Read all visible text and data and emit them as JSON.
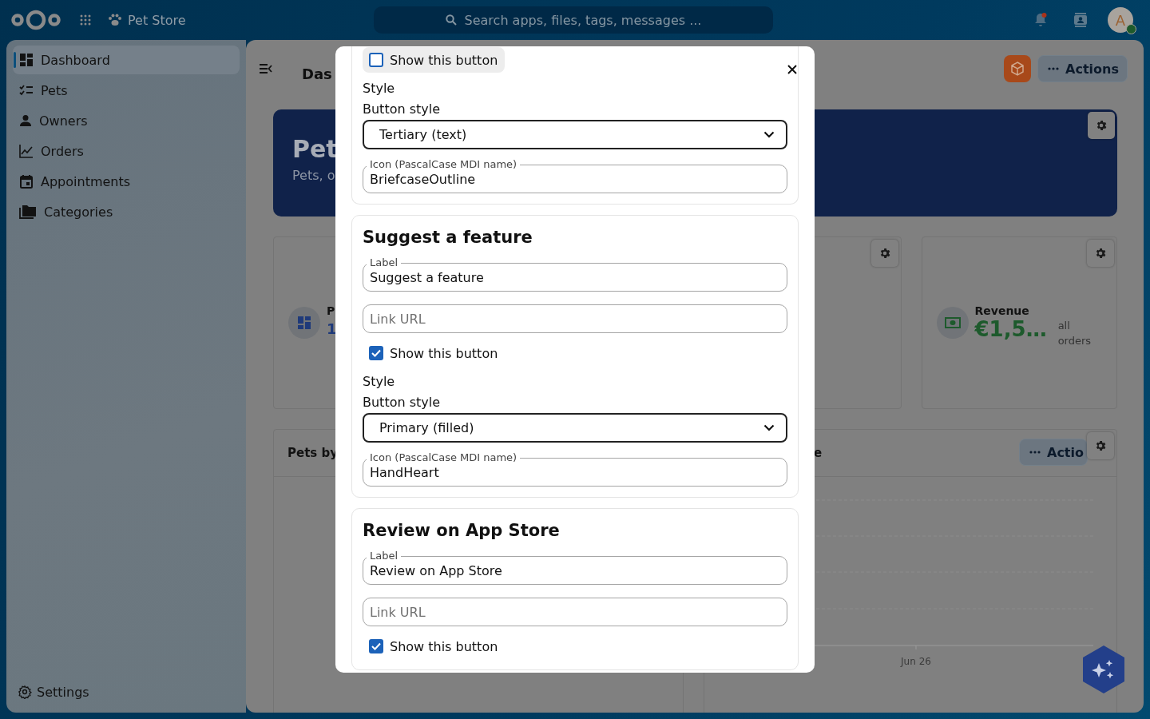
{
  "top_bar": {
    "app_name": "Pet Store",
    "search": {
      "placeholder": "Search apps, files, tags, messages ..."
    },
    "notifications": {
      "unread": true
    },
    "avatar": {
      "initial": "A",
      "online": true
    }
  },
  "sidebar": {
    "items": [
      {
        "label": "Dashboard",
        "selected": true
      },
      {
        "label": "Pets",
        "selected": false
      },
      {
        "label": "Owners",
        "selected": false
      },
      {
        "label": "Orders",
        "selected": false
      },
      {
        "label": "Appointments",
        "selected": false
      },
      {
        "label": "Categories",
        "selected": false
      }
    ],
    "footer": {
      "label": "Settings"
    }
  },
  "header": {
    "title": "Das",
    "actions": {
      "label": "Actions"
    }
  },
  "hero": {
    "title": "Pet",
    "subtitle": "Pets, o"
  },
  "stat_cards": [
    {
      "kind": "stat",
      "label": "P",
      "value": "1",
      "color": "#1f3a7a"
    },
    {
      "kind": "covered"
    },
    {
      "kind": "blank"
    },
    {
      "kind": "stat",
      "label": "Revenue",
      "value": "€1,5…",
      "note": "all orders",
      "color": "#1d5a2c",
      "settings": true
    }
  ],
  "panels": [
    {
      "kind": "list",
      "title": "Pets by"
    },
    {
      "kind": "chart",
      "title": "e",
      "actions": {
        "label": "Actio"
      },
      "x_tick_label": "Jun 26"
    }
  ],
  "modal": {
    "sections": [
      {
        "items": [
          {
            "kind": "checkbox",
            "label": "Show this button",
            "checked": false,
            "highlighted": true
          },
          {
            "kind": "text",
            "text": "Style"
          },
          {
            "kind": "select",
            "label": "Button style",
            "value": "Tertiary (text)"
          },
          {
            "kind": "input",
            "label": "Icon (PascalCase MDI name)",
            "value": "BriefcaseOutline"
          }
        ]
      },
      {
        "heading": "Suggest a feature",
        "items": [
          {
            "kind": "input",
            "label": "Label",
            "value": "Suggest a feature"
          },
          {
            "kind": "input",
            "placeholder": "Link URL"
          },
          {
            "kind": "checkbox",
            "label": "Show this button",
            "checked": true,
            "highlighted": false
          },
          {
            "kind": "text",
            "text": "Style"
          },
          {
            "kind": "select",
            "label": "Button style",
            "value": "Primary (filled)"
          },
          {
            "kind": "input",
            "label": "Icon (PascalCase MDI name)",
            "value": "HandHeart"
          }
        ]
      },
      {
        "heading": "Review on App Store",
        "items": [
          {
            "kind": "input",
            "label": "Label",
            "value": "Review on App Store"
          },
          {
            "kind": "input",
            "placeholder": "Link URL"
          },
          {
            "kind": "checkbox",
            "label": "Show this button",
            "checked": true,
            "highlighted": false
          }
        ]
      }
    ]
  }
}
